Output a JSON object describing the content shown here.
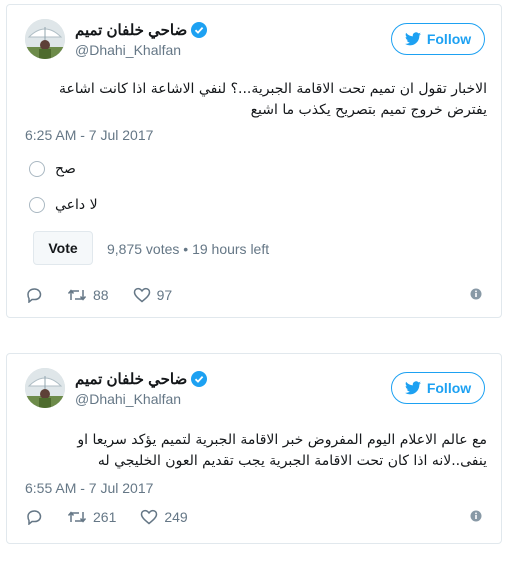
{
  "tweets": [
    {
      "display_name": "ضاحي خلفان تميم",
      "handle": "@Dhahi_Khalfan",
      "follow_label": "Follow",
      "text": "الاخبار تقول ان تميم تحت الاقامة الجبرية...؟ لنفي الاشاعة اذا كانت اشاعة يفترض خروج تميم بتصريح يكذب ما اشيع",
      "timestamp": "6:25 AM - 7 Jul 2017",
      "poll": {
        "options": [
          "صح",
          "لا داعي"
        ],
        "vote_label": "Vote",
        "meta": "9,875 votes • 19 hours left"
      },
      "retweets": "88",
      "likes": "97"
    },
    {
      "display_name": "ضاحي خلفان تميم",
      "handle": "@Dhahi_Khalfan",
      "follow_label": "Follow",
      "text": "مع عالم الاعلام اليوم المفروض خبر الاقامة الجبرية لتميم يؤكد سريعا او ينفى..لانه اذا كان تحت الاقامة الجبرية يجب تقديم العون الخليجي له",
      "timestamp": "6:55 AM - 7 Jul 2017",
      "retweets": "261",
      "likes": "249"
    }
  ],
  "colors": {
    "accent": "#1da1f2",
    "muted": "#657786",
    "border": "#e1e8ed"
  }
}
